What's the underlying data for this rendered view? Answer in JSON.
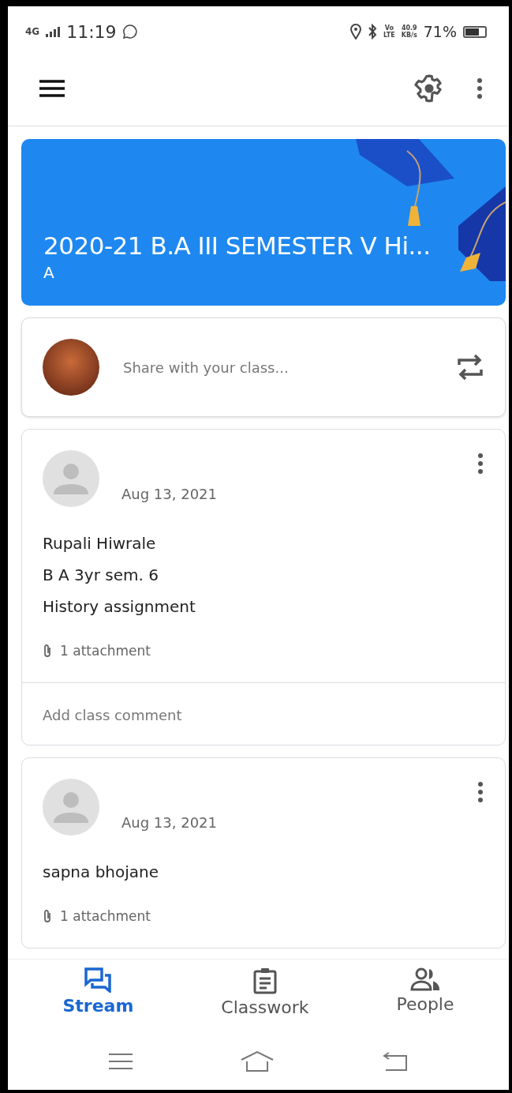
{
  "status_bar": {
    "network": "4G",
    "time": "11:19",
    "volte": [
      "Vo",
      "LTE"
    ],
    "speed": [
      "40.9",
      "KB/s"
    ],
    "battery": {
      "text": "71%",
      "level": 0.71
    }
  },
  "class_banner": {
    "title": "2020-21 B.A III SEMESTER V Hi...",
    "section": "A"
  },
  "share_box": {
    "placeholder": "Share with your class..."
  },
  "posts": [
    {
      "date": "Aug 13, 2021",
      "lines": [
        "Rupali Hiwrale",
        "B A 3yr sem. 6",
        "History assignment"
      ],
      "attachments": "1 attachment",
      "comment_placeholder": "Add class comment"
    },
    {
      "date": "Aug 13, 2021",
      "lines": [
        "sapna bhojane"
      ],
      "attachments": "1 attachment"
    }
  ],
  "tabs": [
    {
      "label": "Stream",
      "selected": true,
      "kind": "stream"
    },
    {
      "label": "Classwork",
      "selected": false,
      "kind": "classwork"
    },
    {
      "label": "People",
      "selected": false,
      "kind": "people"
    }
  ]
}
